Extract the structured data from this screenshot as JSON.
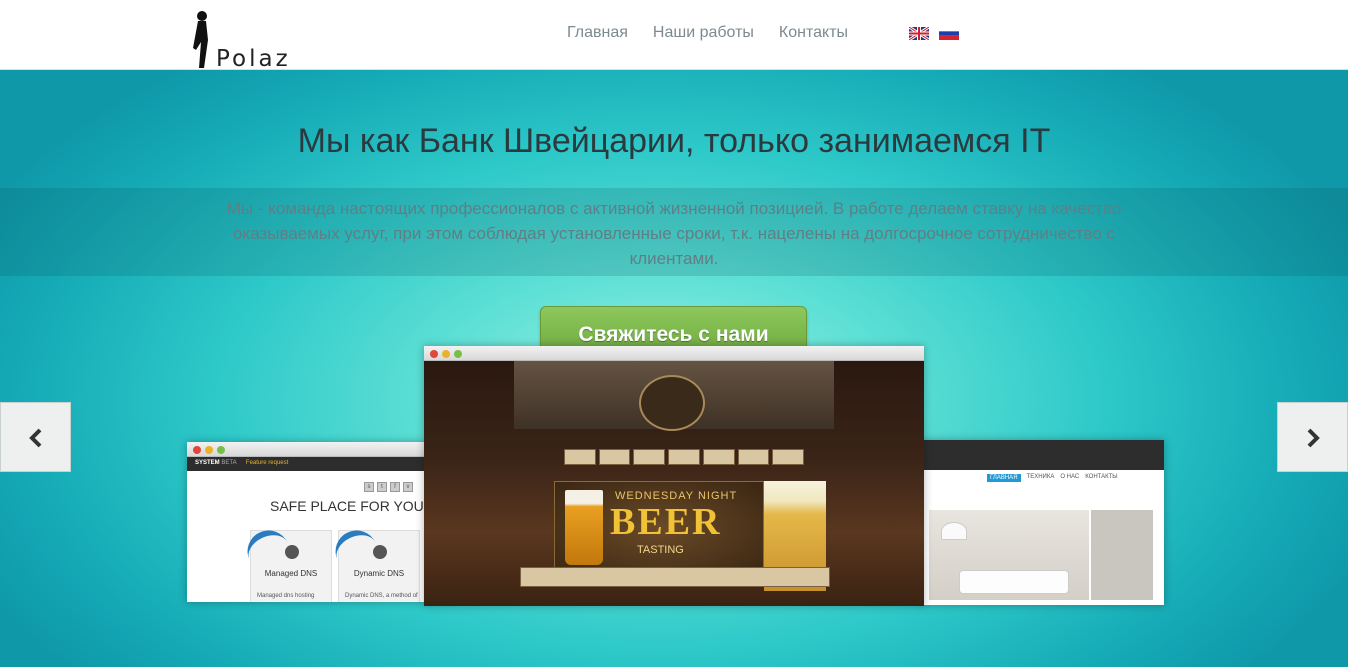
{
  "header": {
    "logo_text": "Polaz",
    "nav": [
      "Главная",
      "Наши работы",
      "Контакты"
    ],
    "languages": [
      "English",
      "Русский"
    ]
  },
  "hero": {
    "title": "Мы как Банк Швейцарии, только занимаемся IT",
    "description": "Мы - команда настоящих профессионалов с активной жизненной позицией. В работе делаем ставку на качество оказываемых услуг, при этом соблюдая установленные сроки, т.к. нацелены на долгосрочное сотрудничество с клиентами.",
    "cta_label": "Свяжитесь с нами"
  },
  "colors": {
    "accent_green": "#76b045",
    "hero_teal": "#2ec9c9",
    "nav_text": "#7c8a91"
  },
  "slides": {
    "left": {
      "brand": "SYSTEM",
      "badge": "BETA",
      "link": "Feature request",
      "heading": "SAFE PLACE FOR YOUR",
      "cards": [
        {
          "label": "Managed DNS",
          "sub": "Managed dns hosting"
        },
        {
          "label": "Dynamic DNS",
          "sub": "Dynamic DNS, a method of"
        }
      ]
    },
    "center": {
      "headline_small": "WEDNESDAY NIGHT",
      "headline_big": "BEER",
      "headline_tail": "TASTING"
    },
    "right": {
      "nav": [
        "ГЛАВНАЯ",
        "ТЕХНИКА",
        "О НАС",
        "КОНТАКТЫ"
      ]
    }
  }
}
